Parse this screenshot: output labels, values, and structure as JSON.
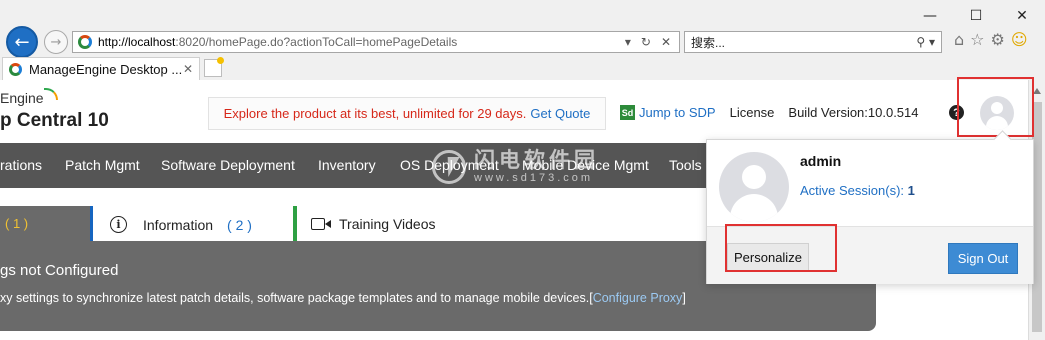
{
  "browser": {
    "url_host": "http://localhost",
    "url_rest": ":8020/homePage.do?actionToCall=homePageDetails",
    "search_placeholder": "搜索...",
    "tab_title": "ManageEngine Desktop ...",
    "window_controls": [
      "—",
      "☐",
      "✕"
    ]
  },
  "header": {
    "logo_top": "Engine",
    "logo_main": "p Central 10",
    "promo_text": "Explore the product at its best, unlimited for 29 days.",
    "promo_link": "Get Quote",
    "sdp_icon": "Sd",
    "sdp_link": "Jump to SDP",
    "license": "License",
    "build": "Build Version:10.0.514",
    "help_glyph": "?"
  },
  "nav": {
    "items": [
      "rations",
      "Patch Mgmt",
      "Software Deployment",
      "Inventory",
      "OS Deployment",
      "Mobile Device Mgmt",
      "Tools"
    ]
  },
  "watermark": {
    "cn": "闪电软件园",
    "url": "www.sd173.com"
  },
  "tabs": {
    "first_count": "( 1 )",
    "info_label": "Information",
    "info_count": "( 2 )",
    "video_label": "Training Videos"
  },
  "alert": {
    "title": "gs not Configured",
    "desc": "xy settings to synchronize latest patch details, software package templates and to manage mobile devices.[",
    "link": "Configure Proxy",
    "suffix": "]"
  },
  "dropdown": {
    "username": "admin",
    "sessions_label": "Active Session(s): ",
    "sessions_count": "1",
    "personalize": "Personalize",
    "signout": "Sign Out"
  },
  "colors": {
    "nav_bg": "#555555",
    "link_blue": "#1f6fc4",
    "promo_red": "#d6281a",
    "signout_bg": "#3d8bd4",
    "highlight_red": "#e03131"
  }
}
